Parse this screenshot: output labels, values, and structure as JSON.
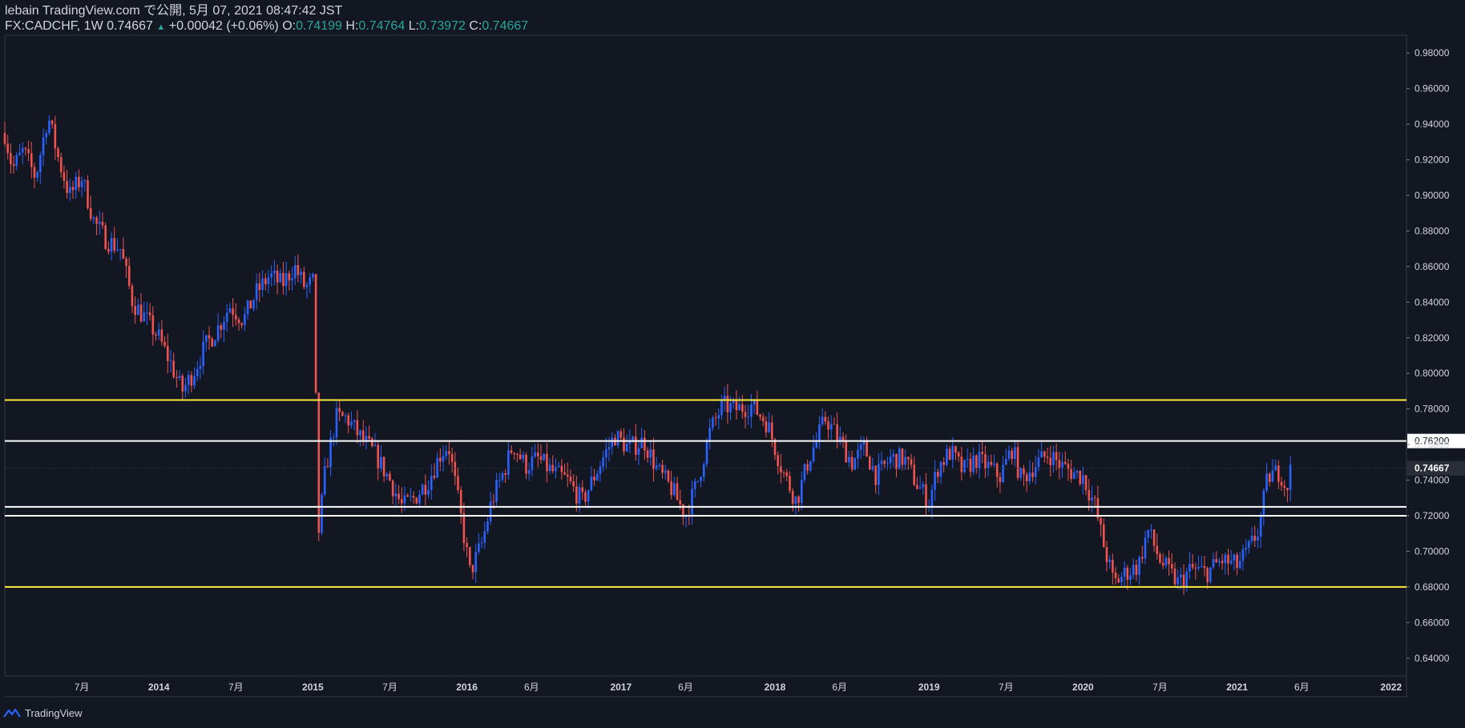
{
  "header": {
    "line1": "lebain TradingView.com で公開, 5月 07, 2021 08:47:42 JST",
    "symbol": "FX:CADCHF, 1W 0.74667",
    "change_arrow": "▲",
    "change": "+0.00042 (+0.06%)",
    "o_label": "O:",
    "o_value": "0.74199",
    "h_label": "H:",
    "h_value": "0.74764",
    "l_label": "L:",
    "l_value": "0.73972",
    "c_label": "C:",
    "c_value": "0.74667"
  },
  "footer": {
    "brand": "TradingView",
    "logo_icon": "tradingview-logo-icon"
  },
  "colors": {
    "background": "#131722",
    "up": "#2962ff",
    "down": "#ef5350",
    "support_resistance": "#ffeb3b",
    "level": "#ffffff",
    "axis_text": "#d1d4dc"
  },
  "chart_data": {
    "type": "candlestick",
    "symbol": "FX:CADCHF",
    "interval": "1W",
    "ylim": [
      0.63,
      0.99
    ],
    "yticks": [
      "0.64000",
      "0.66000",
      "0.68000",
      "0.70000",
      "0.72000",
      "0.74000",
      "0.76000",
      "0.78000",
      "0.80000",
      "0.82000",
      "0.84000",
      "0.86000",
      "0.88000",
      "0.90000",
      "0.92000",
      "0.94000",
      "0.96000",
      "0.98000"
    ],
    "xticks": [
      {
        "label": "7月",
        "t": 2013.5
      },
      {
        "label": "2014",
        "t": 2014.0
      },
      {
        "label": "7月",
        "t": 2014.5
      },
      {
        "label": "2015",
        "t": 2015.0
      },
      {
        "label": "7月",
        "t": 2015.5
      },
      {
        "label": "2016",
        "t": 2016.0
      },
      {
        "label": "6月",
        "t": 2016.42
      },
      {
        "label": "2017",
        "t": 2017.0
      },
      {
        "label": "6月",
        "t": 2017.42
      },
      {
        "label": "2018",
        "t": 2018.0
      },
      {
        "label": "6月",
        "t": 2018.42
      },
      {
        "label": "2019",
        "t": 2019.0
      },
      {
        "label": "7月",
        "t": 2019.5
      },
      {
        "label": "2020",
        "t": 2020.0
      },
      {
        "label": "7月",
        "t": 2020.5
      },
      {
        "label": "2021",
        "t": 2021.0
      },
      {
        "label": "6月",
        "t": 2021.42
      },
      {
        "label": "2022",
        "t": 2022.0
      }
    ],
    "xlim": [
      2013.0,
      2022.1
    ],
    "horizontal_lines": [
      {
        "value": 0.785,
        "color": "#ffeb3b",
        "label": ""
      },
      {
        "value": 0.762,
        "color": "#ffffff",
        "label": "0.76200"
      },
      {
        "value": 0.725,
        "color": "#ffffff",
        "label": ""
      },
      {
        "value": 0.72,
        "color": "#ffffff",
        "label": ""
      },
      {
        "value": 0.68,
        "color": "#ffeb3b",
        "label": ""
      }
    ],
    "last_price": {
      "value": 0.74667,
      "label": "0.74667"
    },
    "price_path": [
      [
        2013.0,
        0.935
      ],
      [
        2013.05,
        0.915
      ],
      [
        2013.12,
        0.925
      ],
      [
        2013.2,
        0.91
      ],
      [
        2013.28,
        0.945
      ],
      [
        2013.35,
        0.92
      ],
      [
        2013.42,
        0.9
      ],
      [
        2013.5,
        0.91
      ],
      [
        2013.58,
        0.885
      ],
      [
        2013.66,
        0.875
      ],
      [
        2013.75,
        0.87
      ],
      [
        2013.83,
        0.84
      ],
      [
        2013.92,
        0.83
      ],
      [
        2014.0,
        0.82
      ],
      [
        2014.08,
        0.805
      ],
      [
        2014.15,
        0.79
      ],
      [
        2014.22,
        0.8
      ],
      [
        2014.3,
        0.815
      ],
      [
        2014.38,
        0.825
      ],
      [
        2014.46,
        0.838
      ],
      [
        2014.55,
        0.83
      ],
      [
        2014.63,
        0.845
      ],
      [
        2014.72,
        0.855
      ],
      [
        2014.8,
        0.85
      ],
      [
        2014.88,
        0.86
      ],
      [
        2014.95,
        0.848
      ],
      [
        2015.01,
        0.852
      ],
      [
        2015.03,
        0.705
      ],
      [
        2015.08,
        0.745
      ],
      [
        2015.15,
        0.775
      ],
      [
        2015.22,
        0.775
      ],
      [
        2015.3,
        0.765
      ],
      [
        2015.4,
        0.755
      ],
      [
        2015.5,
        0.74
      ],
      [
        2015.58,
        0.725
      ],
      [
        2015.66,
        0.73
      ],
      [
        2015.75,
        0.74
      ],
      [
        2015.83,
        0.755
      ],
      [
        2015.88,
        0.76
      ],
      [
        2015.95,
        0.725
      ],
      [
        2016.02,
        0.688
      ],
      [
        2016.1,
        0.705
      ],
      [
        2016.16,
        0.728
      ],
      [
        2016.24,
        0.745
      ],
      [
        2016.3,
        0.76
      ],
      [
        2016.38,
        0.748
      ],
      [
        2016.46,
        0.752
      ],
      [
        2016.55,
        0.745
      ],
      [
        2016.65,
        0.74
      ],
      [
        2016.75,
        0.728
      ],
      [
        2016.88,
        0.752
      ],
      [
        2016.96,
        0.765
      ],
      [
        2017.05,
        0.758
      ],
      [
        2017.15,
        0.762
      ],
      [
        2017.24,
        0.745
      ],
      [
        2017.33,
        0.735
      ],
      [
        2017.42,
        0.72
      ],
      [
        2017.5,
        0.74
      ],
      [
        2017.58,
        0.768
      ],
      [
        2017.66,
        0.782
      ],
      [
        2017.75,
        0.78
      ],
      [
        2017.85,
        0.782
      ],
      [
        2017.95,
        0.772
      ],
      [
        2018.05,
        0.745
      ],
      [
        2018.14,
        0.728
      ],
      [
        2018.22,
        0.752
      ],
      [
        2018.33,
        0.775
      ],
      [
        2018.42,
        0.762
      ],
      [
        2018.5,
        0.75
      ],
      [
        2018.58,
        0.758
      ],
      [
        2018.66,
        0.742
      ],
      [
        2018.75,
        0.752
      ],
      [
        2018.84,
        0.752
      ],
      [
        2018.92,
        0.738
      ],
      [
        2019.0,
        0.728
      ],
      [
        2019.06,
        0.748
      ],
      [
        2019.14,
        0.756
      ],
      [
        2019.22,
        0.745
      ],
      [
        2019.3,
        0.752
      ],
      [
        2019.38,
        0.748
      ],
      [
        2019.46,
        0.742
      ],
      [
        2019.54,
        0.758
      ],
      [
        2019.6,
        0.74
      ],
      [
        2019.68,
        0.748
      ],
      [
        2019.78,
        0.755
      ],
      [
        2019.86,
        0.748
      ],
      [
        2019.94,
        0.744
      ],
      [
        2020.0,
        0.742
      ],
      [
        2020.08,
        0.725
      ],
      [
        2020.13,
        0.705
      ],
      [
        2020.2,
        0.682
      ],
      [
        2020.28,
        0.688
      ],
      [
        2020.36,
        0.692
      ],
      [
        2020.42,
        0.712
      ],
      [
        2020.5,
        0.695
      ],
      [
        2020.56,
        0.688
      ],
      [
        2020.62,
        0.682
      ],
      [
        2020.7,
        0.69
      ],
      [
        2020.8,
        0.688
      ],
      [
        2020.9,
        0.695
      ],
      [
        2021.0,
        0.692
      ],
      [
        2021.07,
        0.7
      ],
      [
        2021.14,
        0.712
      ],
      [
        2021.2,
        0.742
      ],
      [
        2021.28,
        0.745
      ],
      [
        2021.32,
        0.735
      ],
      [
        2021.35,
        0.7467
      ]
    ]
  }
}
